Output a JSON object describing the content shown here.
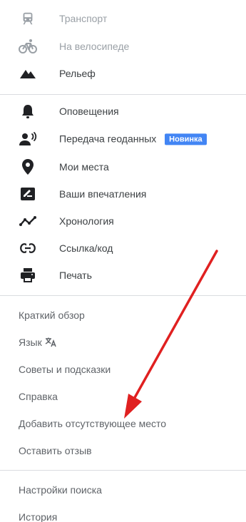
{
  "layers": {
    "transit_label": "Транспорт",
    "bicycling_label": "На велосипеде",
    "terrain_label": "Рельеф"
  },
  "tools": {
    "notifications_label": "Оповещения",
    "location_sharing_label": "Передача геоданных",
    "location_sharing_badge": "Новинка",
    "my_places_label": "Мои места",
    "contributions_label": "Ваши впечатления",
    "timeline_label": "Хронология",
    "share_embed_label": "Ссылка/код",
    "print_label": "Печать"
  },
  "help": {
    "tour_label": "Краткий обзор",
    "language_label": "Язык",
    "tips_label": "Советы и подсказки",
    "help_label": "Справка",
    "add_place_label": "Добавить отсутствующее место",
    "feedback_label": "Оставить отзыв"
  },
  "settings": {
    "search_settings_label": "Настройки поиска",
    "history_label": "История"
  },
  "colors": {
    "text": "#3c4043",
    "text_secondary": "#5f6368",
    "disabled": "#9aa0a6",
    "icon": "#202124",
    "badge": "#4285f4",
    "annotation_arrow": "#e02020"
  },
  "icons": {
    "transit": "train-icon",
    "bicycling": "bicycle-icon",
    "terrain": "mountain-icon",
    "notifications": "bell-icon",
    "location_sharing": "person-share-icon",
    "my_places": "pin-icon",
    "contributions": "edit-review-icon",
    "timeline": "timeline-icon",
    "share_embed": "link-icon",
    "print": "printer-icon",
    "language": "translate-icon"
  }
}
